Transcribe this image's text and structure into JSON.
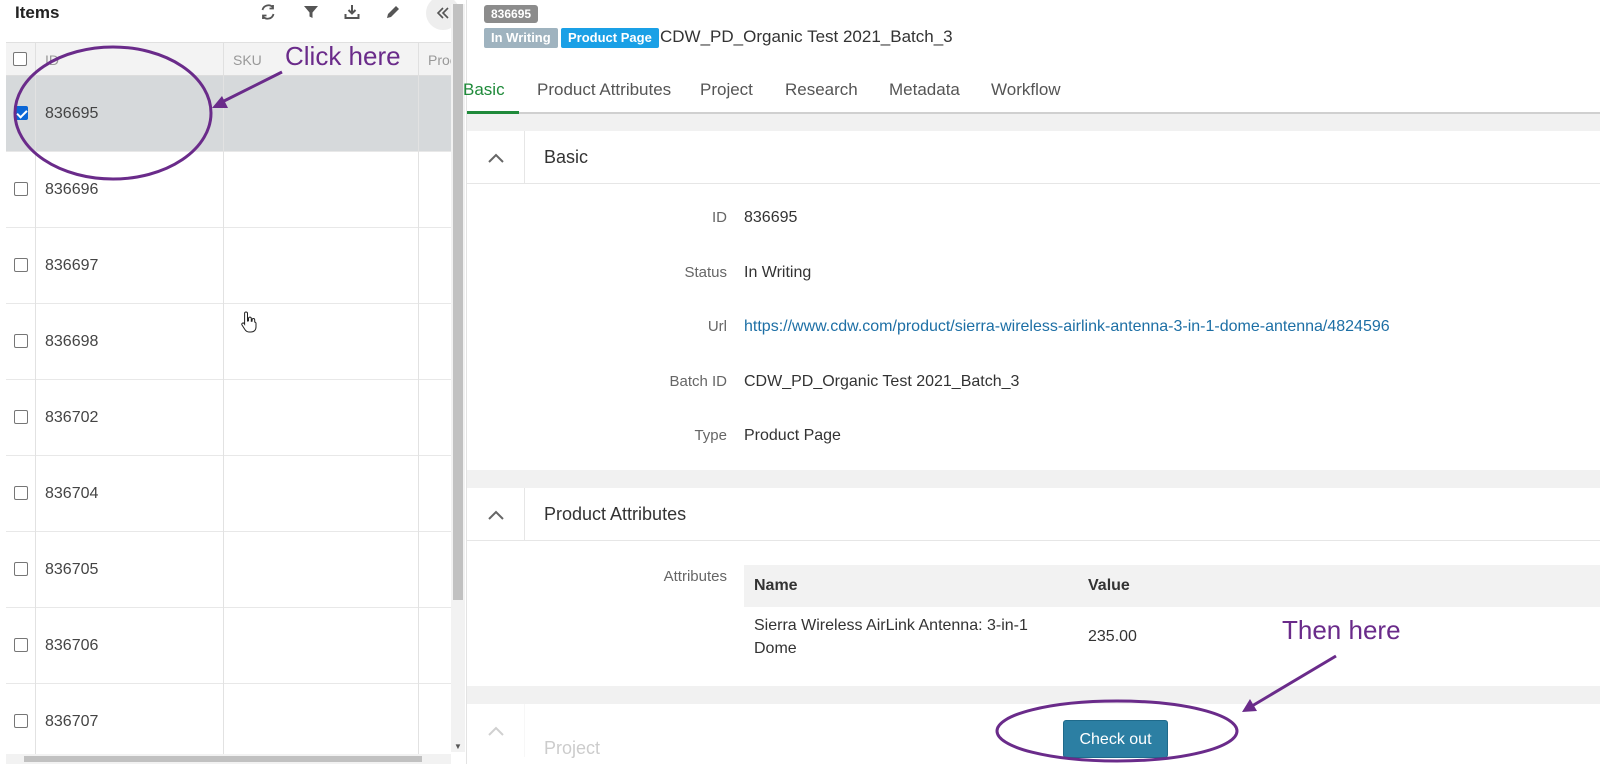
{
  "left_panel": {
    "title": "Items",
    "tools": [
      "refresh-icon",
      "filter-icon",
      "download-icon",
      "edit-icon"
    ],
    "collapse_icon": "double-chevron-left-icon",
    "columns": [
      "ID",
      "SKU",
      "Proc"
    ],
    "rows": [
      {
        "id": "836695",
        "selected": true
      },
      {
        "id": "836696",
        "selected": false
      },
      {
        "id": "836697",
        "selected": false
      },
      {
        "id": "836698",
        "selected": false
      },
      {
        "id": "836702",
        "selected": false
      },
      {
        "id": "836704",
        "selected": false
      },
      {
        "id": "836705",
        "selected": false
      },
      {
        "id": "836706",
        "selected": false
      },
      {
        "id": "836707",
        "selected": false
      }
    ]
  },
  "header": {
    "id_badge": "836695",
    "status_badge": "In Writing",
    "type_badge": "Product Page",
    "title": "CDW_PD_Organic Test 2021_Batch_3"
  },
  "tabs": [
    "Basic",
    "Product Attributes",
    "Project",
    "Research",
    "Metadata",
    "Workflow"
  ],
  "basic": {
    "title": "Basic",
    "fields": [
      {
        "label": "ID",
        "value": "836695"
      },
      {
        "label": "Status",
        "value": "In Writing"
      },
      {
        "label": "Url",
        "value": "https://www.cdw.com/product/sierra-wireless-airlink-antenna-3-in-1-dome-antenna/4824596"
      },
      {
        "label": "Batch ID",
        "value": "CDW_PD_Organic Test 2021_Batch_3"
      },
      {
        "label": "Type",
        "value": "Product Page"
      }
    ]
  },
  "product_attributes": {
    "title": "Product Attributes",
    "label": "Attributes",
    "columns": [
      "Name",
      "Value"
    ],
    "rows": [
      {
        "name_line1": "Sierra Wireless AirLink Antenna: 3-in-1",
        "name_line2": "Dome",
        "value": "235.00"
      }
    ]
  },
  "project": {
    "title": "Project"
  },
  "checkout_button": "Check out",
  "annotations": {
    "first": "Click here",
    "second": "Then here",
    "color": "#6a2b8a"
  },
  "colors": {
    "active_tab": "#1f8a3a",
    "link": "#1d6fa5",
    "type_badge": "#1aa0e6",
    "status_badge": "#9fb3bf",
    "button": "#2c7fa3"
  }
}
